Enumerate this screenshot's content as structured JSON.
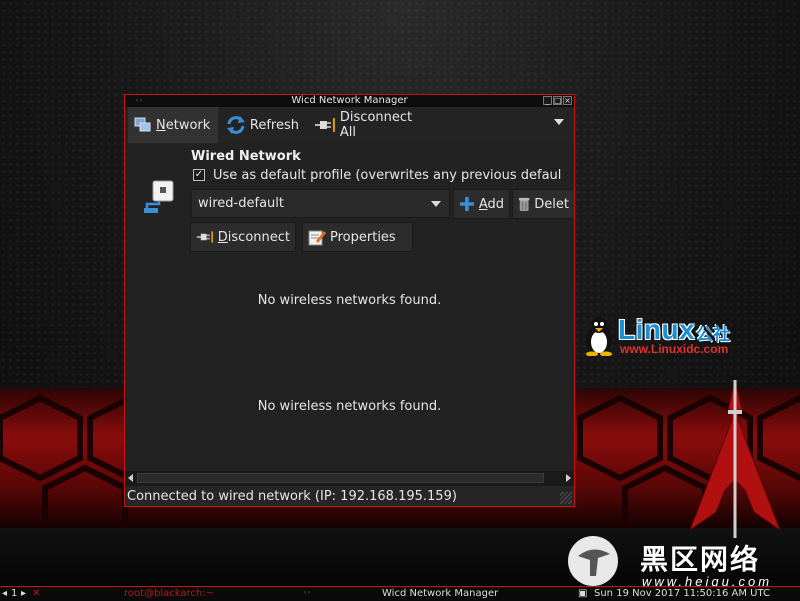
{
  "window": {
    "title": "Wicd Network Manager",
    "titlebar_buttons": [
      "_",
      "□",
      "×"
    ]
  },
  "toolbar": {
    "network_label_pre": "",
    "network_label_ul": "N",
    "network_label_post": "etwork",
    "refresh_label": "Refresh",
    "disconnect_all_label": "Disconnect All"
  },
  "wired": {
    "title": "Wired Network",
    "checkbox_checked": "✓",
    "default_profile_label": "Use as default profile (overwrites any previous defaul",
    "profile_value": "wired-default",
    "add_ul": "A",
    "add_post": "dd",
    "delete_label": "Delet",
    "disconnect_ul": "D",
    "disconnect_post": "isconnect",
    "properties_label": "Properties"
  },
  "messages": [
    "No wireless networks found.",
    "No wireless networks found."
  ],
  "status": {
    "text": "Connected to wired network (IP: 192.168.195.159)"
  },
  "taskbar": {
    "workspace": "1",
    "terminal_label": "root@blackarch:~",
    "wicd_label": "Wicd Network Manager",
    "clock": "Sun 19 Nov 2017 11:50:16 AM UTC"
  },
  "watermarks": {
    "linux_word": "Linux",
    "linux_cn": "公社",
    "linux_url": "www.Linuxidc.com",
    "heigu_cn": "黑区网络",
    "heigu_url": "www.heiqu.com"
  },
  "colors": {
    "window_border": "#c41414",
    "window_bg": "#262626",
    "accent_blue": "#3a8fd8"
  },
  "icons": {
    "network": "network-icon",
    "refresh": "refresh-icon",
    "disconnect": "disconnect-plug-icon",
    "add": "plus-icon",
    "delete": "trash-icon",
    "properties": "properties-icon",
    "wired": "wired-network-icon"
  }
}
